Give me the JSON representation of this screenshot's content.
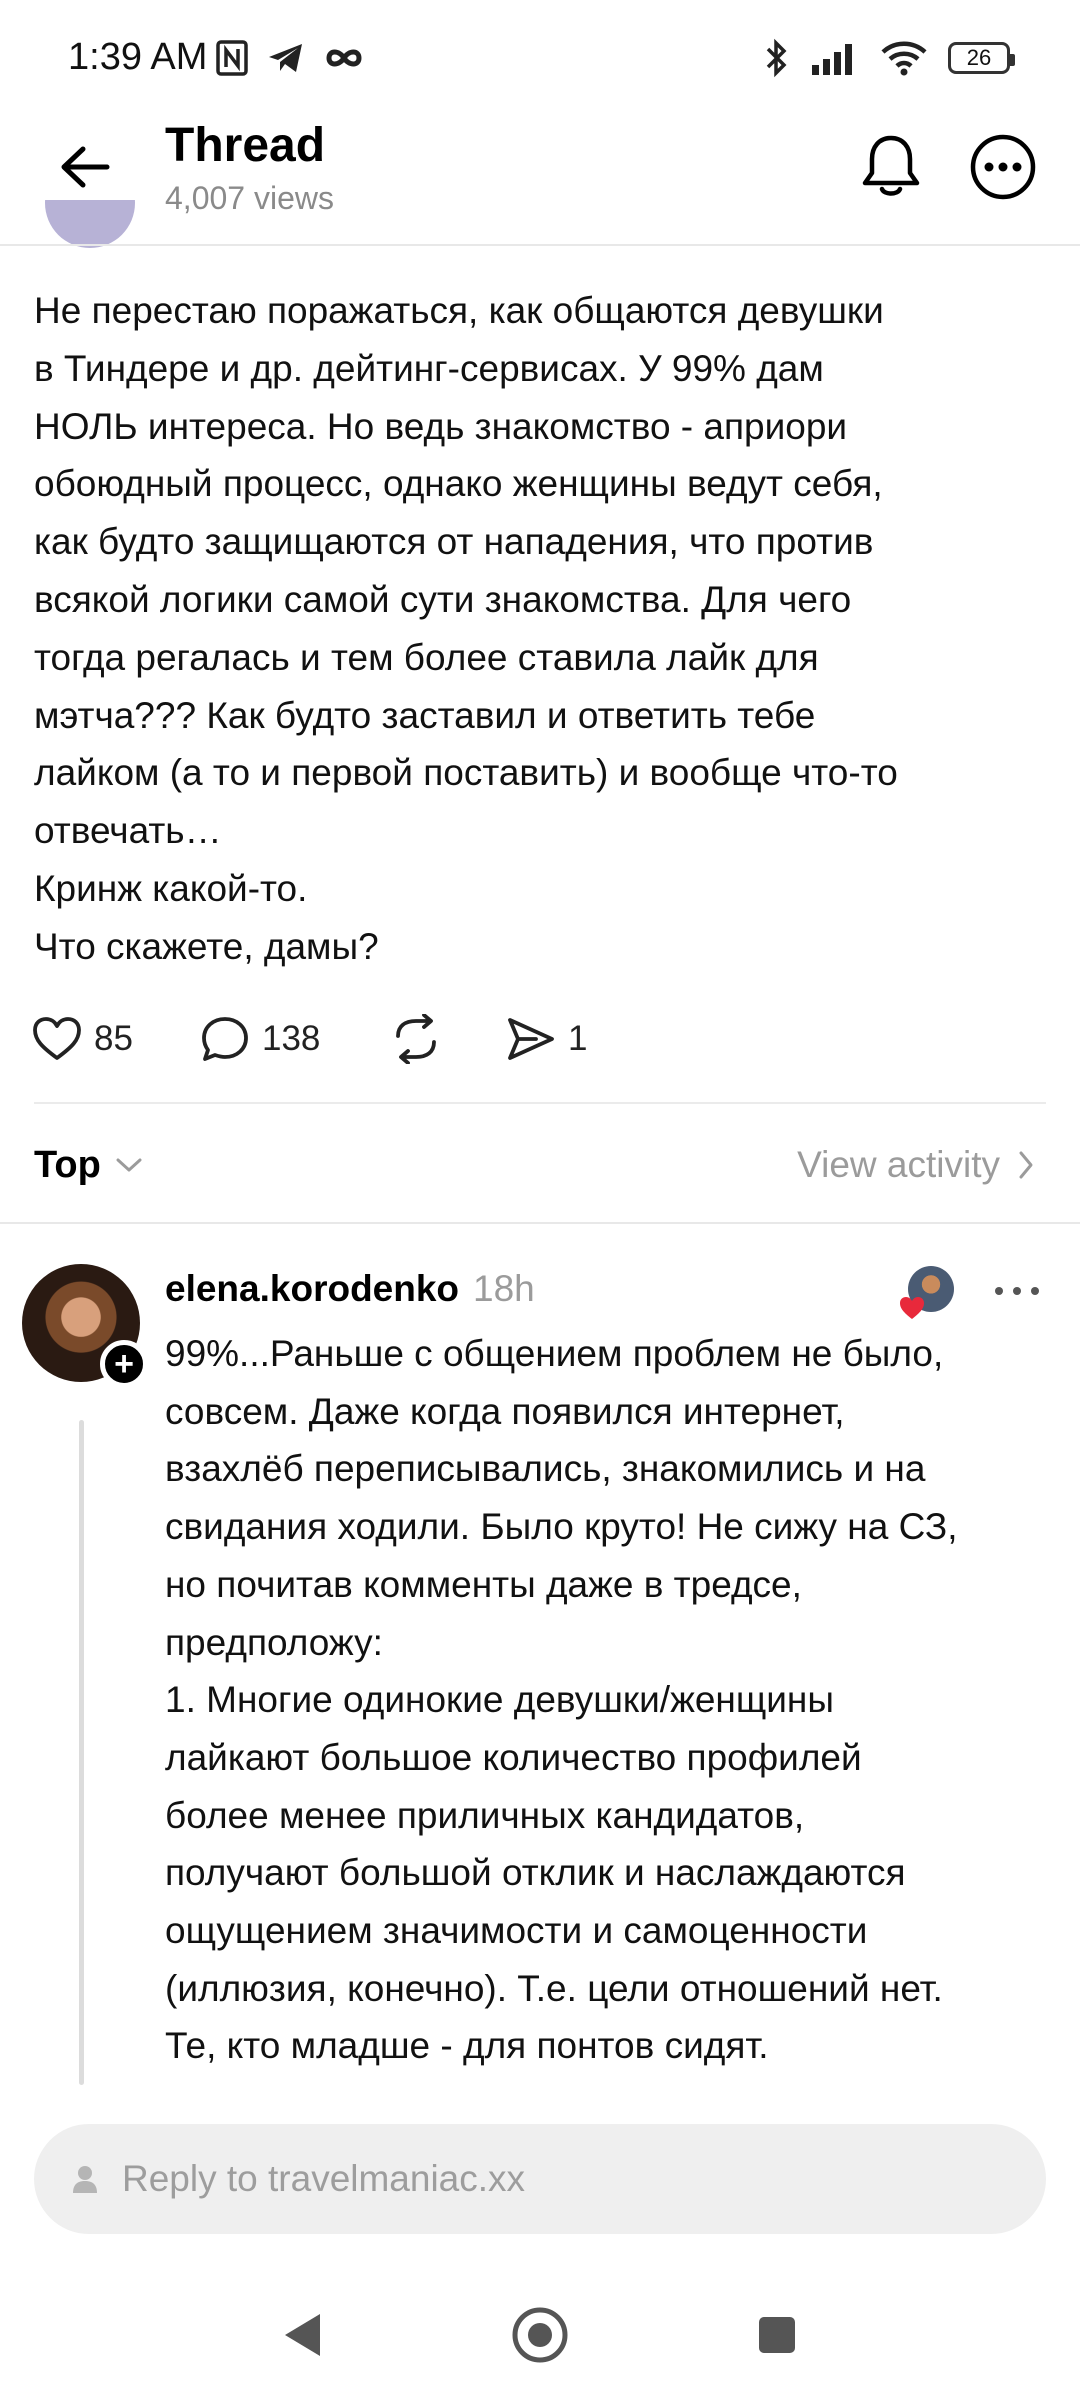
{
  "status_bar": {
    "time": "1:39 AM",
    "left_icons": [
      "nfc-icon",
      "telegram-icon",
      "infinity-icon"
    ],
    "right_icons": [
      "bluetooth-icon",
      "signal-icon",
      "wifi-icon"
    ],
    "battery": "26"
  },
  "header": {
    "title": "Thread",
    "views": "4,007 views",
    "icons": [
      "back-arrow-icon",
      "bell-icon",
      "more-circle-icon"
    ]
  },
  "post": {
    "text": "Не перестаю поражаться, как общаются девушки\nв Тиндере и др. дейтинг-сервисах. У 99% дам\nНОЛЬ интереса. Но ведь знакомство - априори\nобоюдный процесс, однако женщины ведут себя,\nкак будто защищаются от нападения, что против\nвсякой логики самой сути знакомства. Для чего\nтогда регалась и тем более ставила лайк для\nмэтча??? Как будто заставил и ответить тебе\nлайком (а то и первой поставить) и вообще что-то\nотвечать…\nКринж какой-то.\nЧто скажете, дамы?",
    "likes": "85",
    "comments": "138",
    "shares": "1"
  },
  "sort": {
    "label": "Top",
    "view_activity": "View activity"
  },
  "reply": {
    "author": "elena.korodenko",
    "time": "18h",
    "text": "99%...Раньше с общением проблем не было,\nсовсем. Даже когда появился интернет,\nвзахлёб переписывались, знакомились и на\nсвидания ходили. Было круто! Не сижу на СЗ,\nно почитав комменты даже в тредсе,\nпредположу:\n1. Многие одинокие девушки/женщины\nлайкают большое количество профилей\nболее менее приличных кандидатов,\nполучают большой отклик и наслаждаются\nощущением значимости и самоценности\n(иллюзия, конечно). Т.е. цели отношений нет.\nТе, кто младше - для понтов сидят."
  },
  "reply_input": {
    "placeholder": "Reply to travelmaniac.xx"
  },
  "colors": {
    "text": "#111111",
    "muted": "#9b9b9b",
    "divider": "#e8e8e8",
    "input_bg": "#efefef",
    "heart_red": "#e8293b"
  }
}
